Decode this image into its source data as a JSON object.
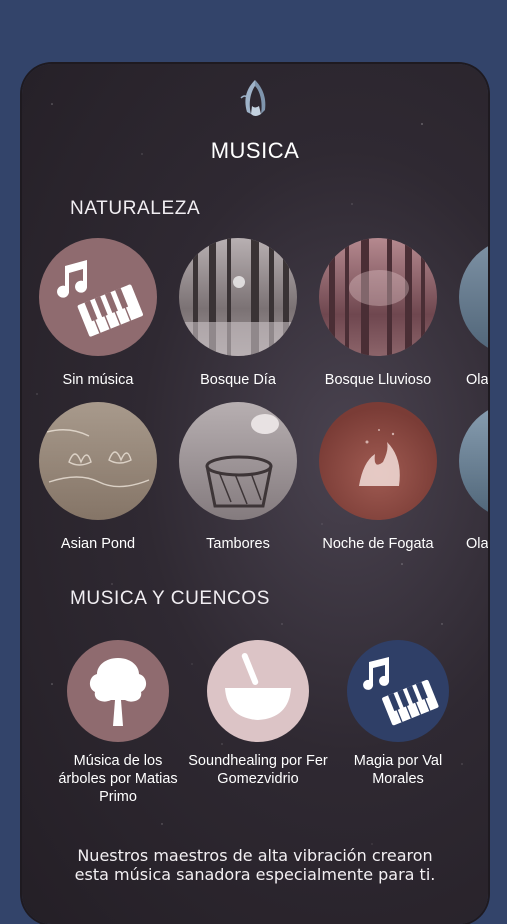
{
  "app": {
    "title": "MUSICA",
    "logo_icon": "seashell-icon",
    "accent_rose": "#8e6a6e",
    "accent_navy": "#2f3f67",
    "accent_pink": "#dcc4c6"
  },
  "naturaleza": {
    "heading": "NATURALEZA",
    "row1": [
      {
        "label": "Sin música",
        "icon": "music-piano-icon"
      },
      {
        "label": "Bosque Día",
        "icon": "forest-day-image"
      },
      {
        "label": "Bosque Lluvioso",
        "icon": "rainy-forest-image"
      },
      {
        "label": "Ola",
        "icon": "waves-image"
      }
    ],
    "row2": [
      {
        "label": "Asian Pond",
        "icon": "lotus-pond-image"
      },
      {
        "label": "Tambores",
        "icon": "drums-image"
      },
      {
        "label": "Noche de Fogata",
        "icon": "bonfire-image"
      },
      {
        "label": "Ola",
        "icon": "ocean-image"
      }
    ]
  },
  "cuencos": {
    "heading": "MUSICA Y CUENCOS",
    "items": [
      {
        "label": "Música de los árboles por Matias Primo",
        "icon": "tree-icon"
      },
      {
        "label": "Soundhealing por Fer Gomezvidrio",
        "icon": "singing-bowl-icon"
      },
      {
        "label": "Magia por Val Morales",
        "icon": "music-piano-icon"
      }
    ]
  },
  "footer": {
    "text": "Nuestros maestros de alta vibración crearon esta música sanadora especialmente para ti."
  }
}
